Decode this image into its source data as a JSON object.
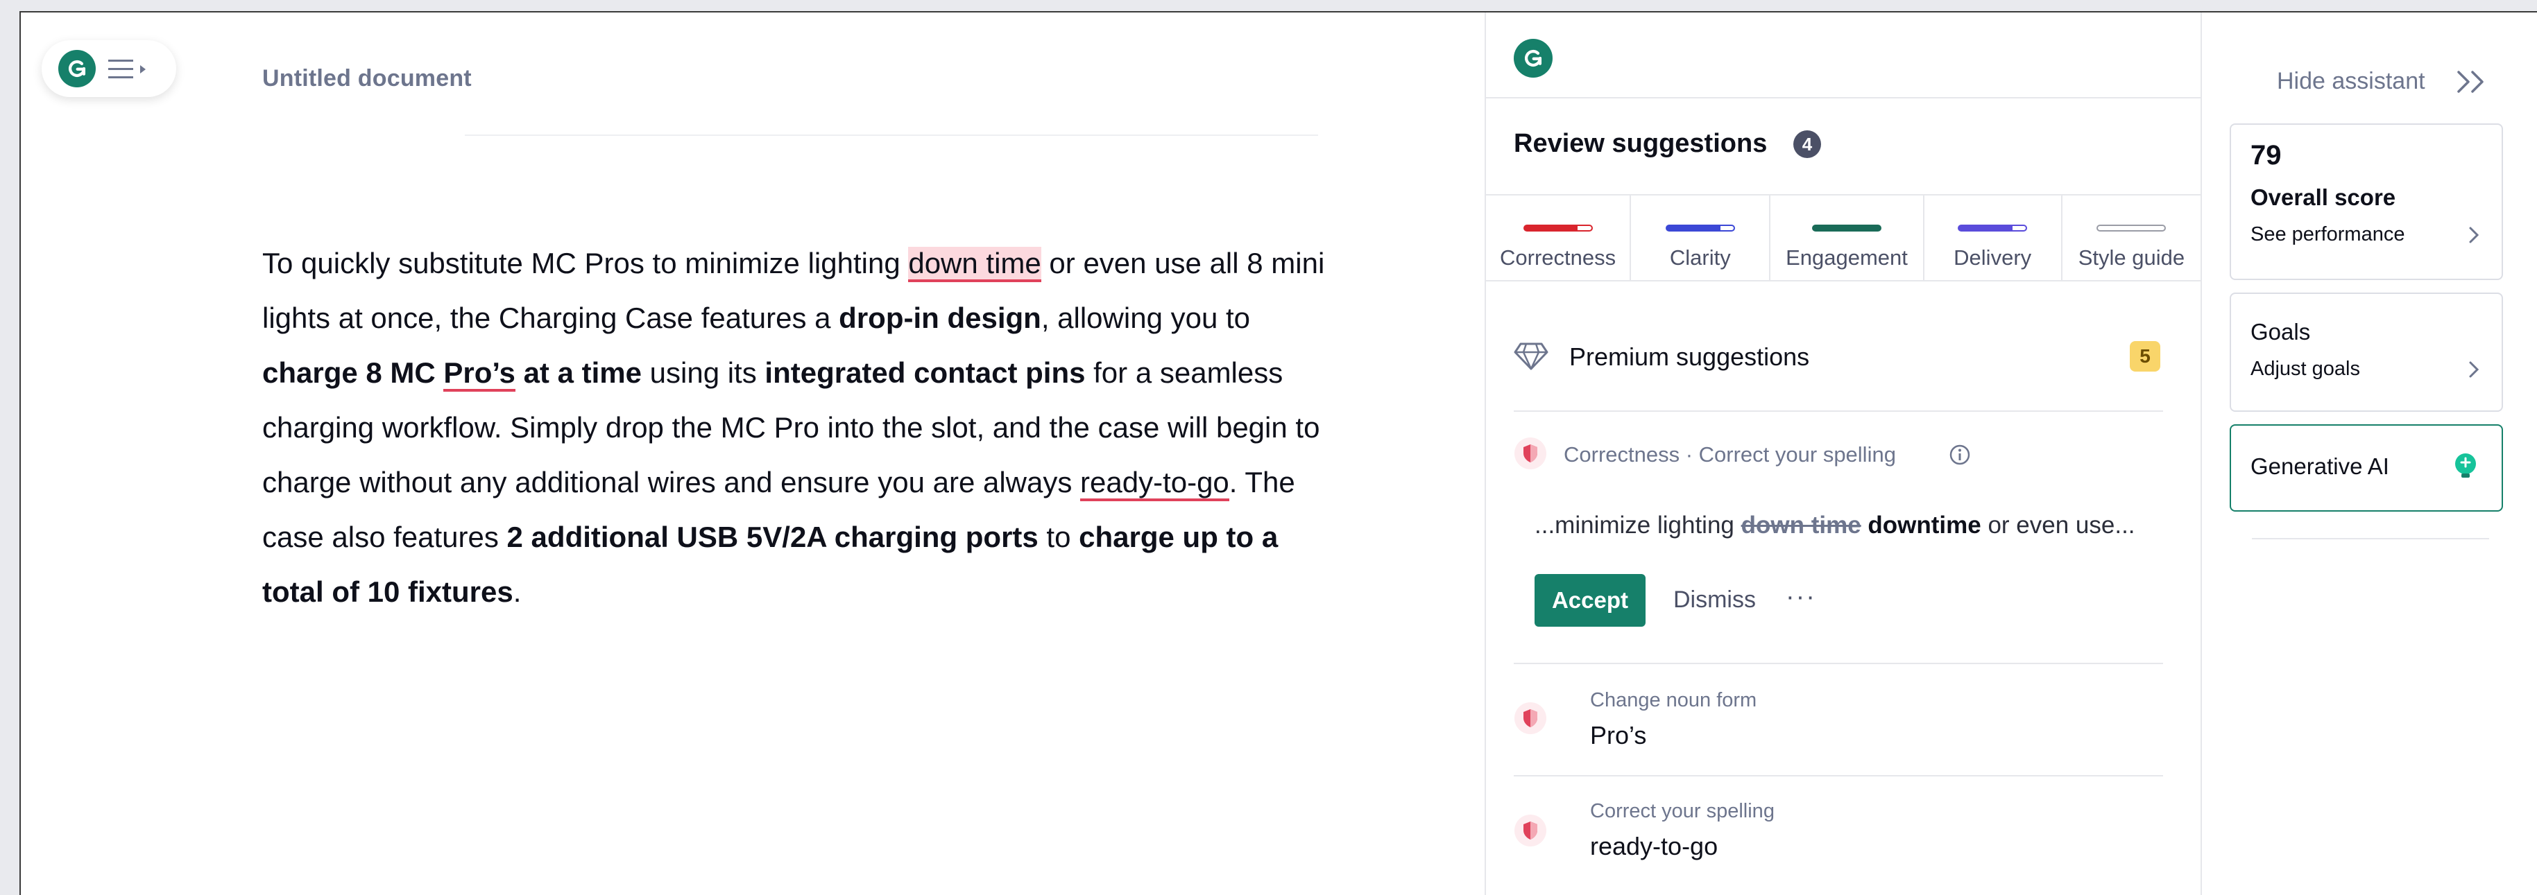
{
  "editor": {
    "doc_title": "Untitled document",
    "body": {
      "p1": "To quickly substitute MC Pros to minimize lighting ",
      "flag1": "down time",
      "p2": " or even use all 8 mini lights at once, the Charging Case features a ",
      "b1": "drop-in design",
      "p3": ", allowing you to ",
      "b2a": "charge 8 MC ",
      "flag2": "Pro’s",
      "b2b": " at a time",
      "p4": " using its ",
      "b3": "integrated contact pins",
      "p5": " for a seamless charging workflow. Simply drop the MC Pro into the slot, and the case will begin to charge without any additional wires and ensure you are always ",
      "flag3": "ready-to-go",
      "p6": ". The case also features ",
      "b4": "2 additional USB 5V/2A charging ports",
      "p7": " to ",
      "b5": "charge up to a total of 10 fixtures",
      "p8": "."
    }
  },
  "assistant": {
    "review_title": "Review suggestions",
    "review_count": "4",
    "tabs": [
      {
        "label": "Correctness",
        "color": "#d9252d",
        "fill": 0.8
      },
      {
        "label": "Clarity",
        "color": "#3c48d6",
        "fill": 0.8
      },
      {
        "label": "Engagement",
        "color": "#1a6b58",
        "fill": 1.0
      },
      {
        "label": "Delivery",
        "color": "#5a4cdb",
        "fill": 0.8
      },
      {
        "label": "Style guide",
        "color": "#9a9ca6",
        "fill": 0.0
      }
    ],
    "premium": {
      "label": "Premium suggestions",
      "count": "5"
    },
    "active_card": {
      "header": "Correctness · Correct your spelling",
      "snippet_before": "...minimize lighting ",
      "snippet_strike": "down time",
      "snippet_insert": "downtime",
      "snippet_after": " or even use...",
      "accept_label": "Accept",
      "dismiss_label": "Dismiss",
      "more_label": "···"
    },
    "suggestions": [
      {
        "title": "Change noun form",
        "value": "Pro’s"
      },
      {
        "title": "Correct your spelling",
        "value": "ready-to-go"
      }
    ]
  },
  "rail": {
    "hide_label": "Hide assistant",
    "score": {
      "value": "79",
      "label": "Overall score",
      "link": "See performance"
    },
    "goals": {
      "title": "Goals",
      "link": "Adjust goals"
    },
    "genai": {
      "label": "Generative AI"
    }
  },
  "colors": {
    "brand": "#16806a",
    "error": "#e0425b",
    "highlight": "#fcd9de"
  }
}
